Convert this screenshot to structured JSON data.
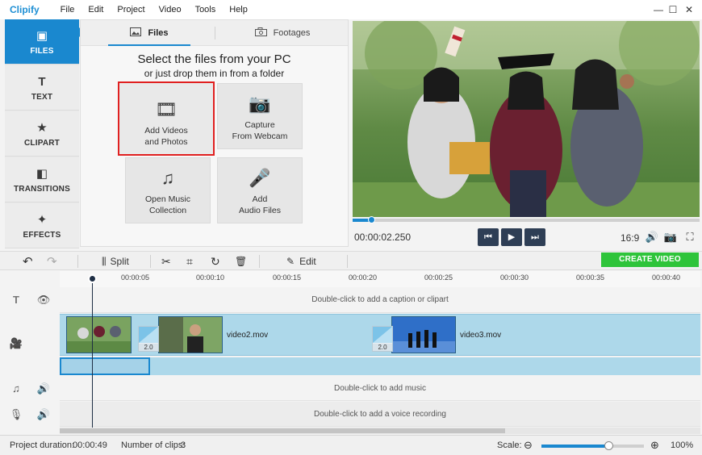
{
  "app": {
    "logo": "Clipify",
    "menu": [
      "File",
      "Edit",
      "Project",
      "Video",
      "Tools",
      "Help"
    ],
    "window_controls": [
      "—",
      "☐",
      "✕"
    ]
  },
  "leftnav": {
    "items": [
      {
        "label": "FILES",
        "icon": "film-image-icon",
        "glyph": "▣",
        "active": true
      },
      {
        "label": "TEXT",
        "icon": "text-icon",
        "glyph": "T",
        "active": false
      },
      {
        "label": "CLIPART",
        "icon": "star-icon",
        "glyph": "★",
        "active": false
      },
      {
        "label": "TRANSITIONS",
        "icon": "transitions-icon",
        "glyph": "◧",
        "active": false
      },
      {
        "label": "EFFECTS",
        "icon": "magic-wand-icon",
        "glyph": "✦",
        "active": false
      }
    ]
  },
  "files_panel": {
    "tabs": [
      {
        "label": "Files",
        "icon": "image-icon",
        "active": true
      },
      {
        "label": "Footages",
        "icon": "camera-icon",
        "active": false
      }
    ],
    "headline": "Select the files from your PC",
    "subheadline": "or just drop them in from a folder",
    "tiles": [
      {
        "label1": "Add Videos",
        "label2": "and Photos",
        "icon": "video-photo-icon",
        "glyph": "🎞",
        "highlighted": true
      },
      {
        "label1": "Capture",
        "label2": "From Webcam",
        "icon": "webcam-icon",
        "glyph": "📷",
        "highlighted": false
      },
      {
        "label1": "Open Music",
        "label2": "Collection",
        "icon": "music-notes-icon",
        "glyph": "♫",
        "highlighted": false
      },
      {
        "label1": "Add",
        "label2": "Audio Files",
        "icon": "microphone-icon",
        "glyph": "🎤",
        "highlighted": false
      }
    ]
  },
  "player": {
    "timecode": "00:00:02.250",
    "progress": 0.055,
    "aspect": "16:9",
    "controls": {
      "prev": "⏮",
      "play": "▶",
      "next": "⏭",
      "volume": "🔊",
      "snapshot": "📷",
      "fullscreen": "⛶"
    }
  },
  "toolbar": {
    "undo": "↶",
    "redo": "↷",
    "split_label": "Split",
    "split_icon": "⫼",
    "cut_icon": "✂",
    "crop_icon": "⌗",
    "rotate_icon": "↻",
    "delete_icon": "🗑",
    "edit_label": "Edit",
    "edit_icon": "✎",
    "create_label": "CREATE VIDEO"
  },
  "timeline": {
    "ruler_labels": [
      "00:00:05",
      "00:00:10",
      "00:00:15",
      "00:00:20",
      "00:00:25",
      "00:00:30",
      "00:00:35",
      "00:00:40"
    ],
    "caption_hint": "Double-click to add a caption or clipart",
    "music_hint": "Double-click to add music",
    "voice_hint": "Double-click to add a voice recording",
    "clips": [
      {
        "name": ""
      },
      {
        "name": "video2.mov"
      },
      {
        "name": "video3.mov"
      }
    ],
    "transitions": [
      {
        "duration": "2.0"
      },
      {
        "duration": "2.0"
      }
    ],
    "track_icons": {
      "text": "T",
      "eye": "👁",
      "video": "🎥",
      "music": "♫",
      "speaker": "🔊",
      "mic": "🎙"
    }
  },
  "status": {
    "duration_label": "Project duration:",
    "duration_value": "00:00:49",
    "clips_label": "Number of clips:",
    "clips_value": "3",
    "scale_label": "Scale:",
    "zoom_out": "⊖",
    "zoom_in": "⊕",
    "zoom_value": "100%",
    "zoom_fraction": 0.66
  }
}
